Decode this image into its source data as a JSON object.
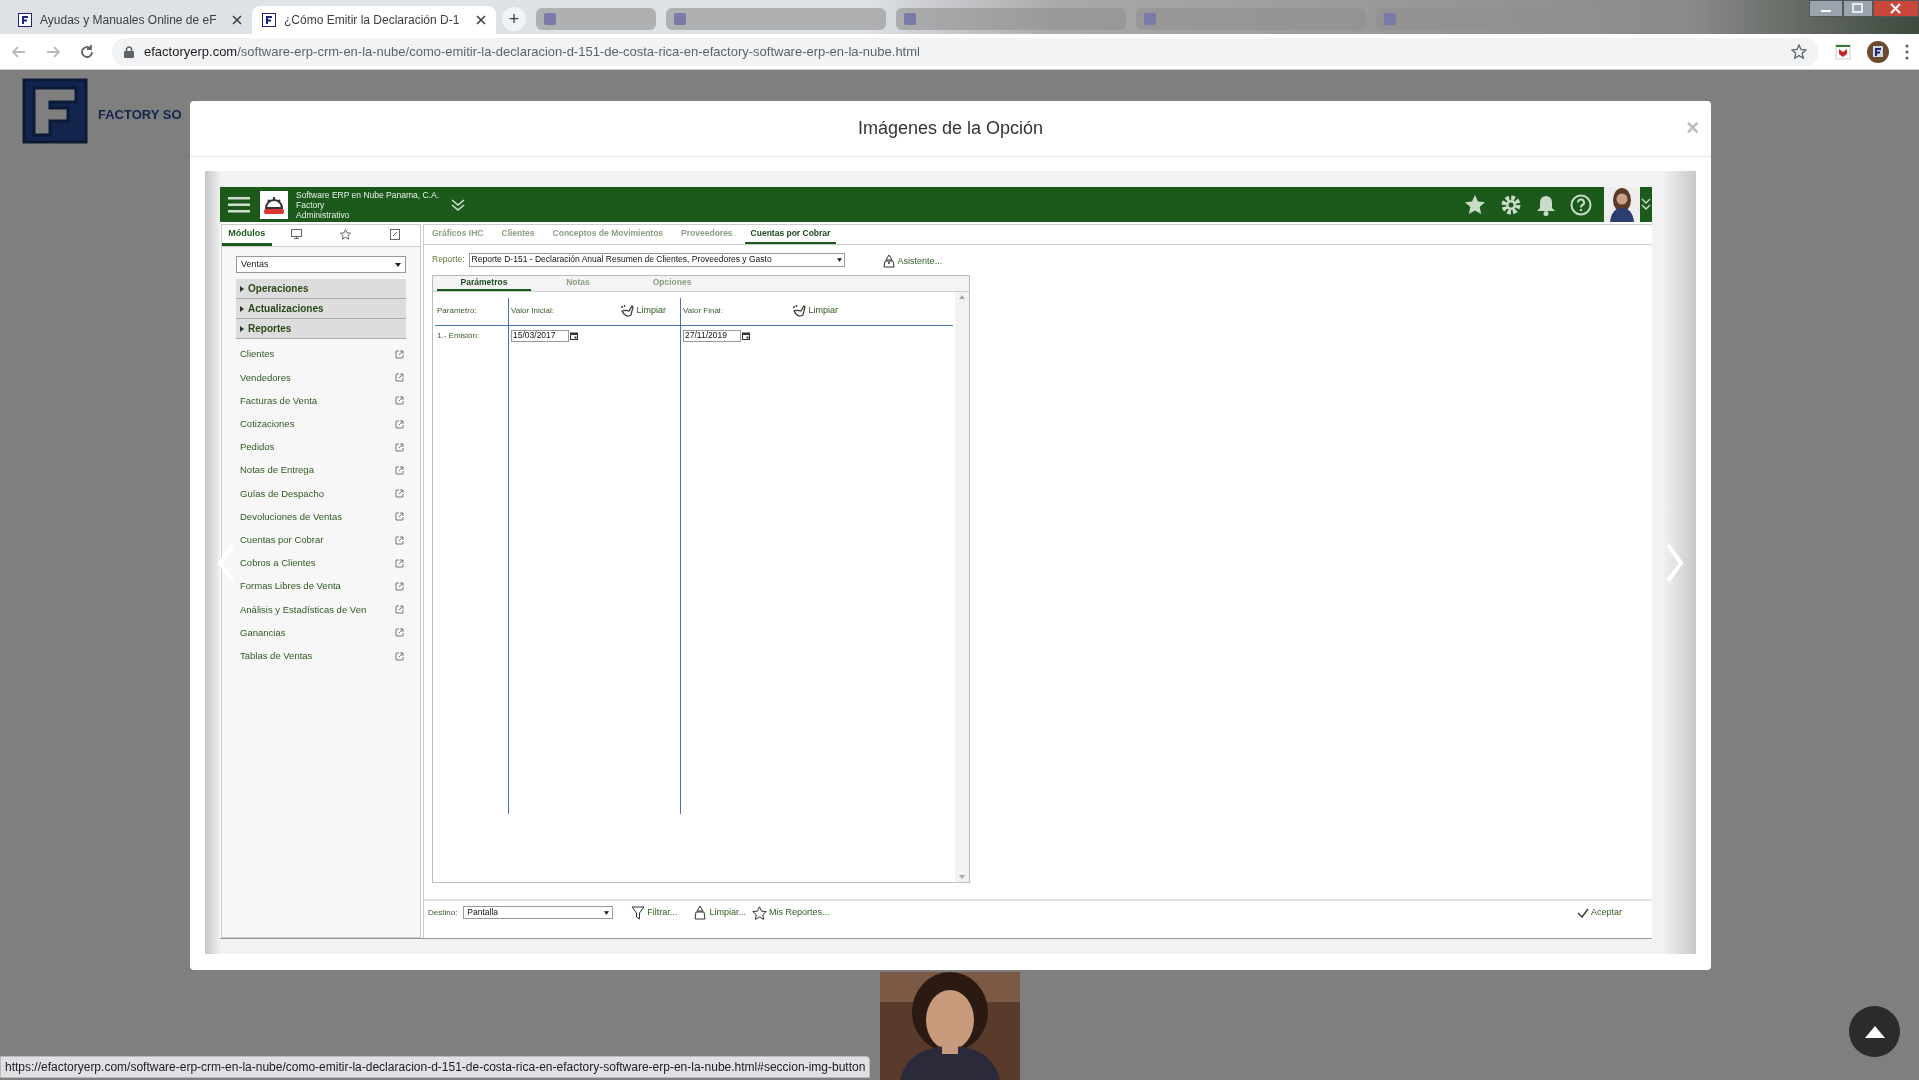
{
  "browser": {
    "tabs": [
      {
        "title": "Ayudas y Manuales Online de eF",
        "selected": false
      },
      {
        "title": "¿Cómo Emitir la Declaración D-1",
        "selected": true
      }
    ],
    "new_tab": "+",
    "url_domain": "efactoryerp.com",
    "url_path": "/software-erp-crm-en-la-nube/como-emitir-la-declaracion-d-151-de-costa-rica-en-efactory-software-erp-en-la-nube.html"
  },
  "page": {
    "brand": "FACTORY SO"
  },
  "modal": {
    "title": "Imágenes de la Opción",
    "close": "×"
  },
  "app": {
    "company": "Software ERP en Nube Panama, C.A.",
    "user": "Factory",
    "role": "Administrativo",
    "sidebar_tabs": [
      {
        "kind": "text",
        "label": "Módulos",
        "selected": true
      },
      {
        "kind": "monitor",
        "selected": false
      },
      {
        "kind": "star",
        "selected": false
      },
      {
        "kind": "note",
        "selected": false
      }
    ],
    "module_select": "Ventas",
    "groups": [
      {
        "label": "Operaciones",
        "expanded": false
      },
      {
        "label": "Actualizaciones",
        "expanded": false
      },
      {
        "label": "Reportes",
        "expanded": false
      }
    ],
    "items": [
      "Clientes",
      "Vendedores",
      "Facturas de Venta",
      "Cotizaciones",
      "Pedidos",
      "Notas de Entrega",
      "Guías de Despacho",
      "Devoluciones de Ventas",
      "Cuentas por Cobrar",
      "Cobros a Clientes",
      "Formas Libres de Venta",
      "Análisis y Estadísticas de Ven",
      "Ganancias",
      "Tablas de Ventas"
    ],
    "tabs": [
      {
        "label": "Gráficos IHC",
        "selected": false
      },
      {
        "label": "Clientes",
        "selected": false
      },
      {
        "label": "Conceptos de Movimientos",
        "selected": false
      },
      {
        "label": "Proveedores",
        "selected": false
      },
      {
        "label": "Cuentas por Cobrar",
        "selected": true
      }
    ],
    "report_label": "Reporte:",
    "report_value": "Reporte D-151 - Declaración Anual Resumen de Clientes, Proveedores y Gasto",
    "wizard": "Asistente...",
    "sub_tabs": [
      {
        "label": "Parámetros",
        "selected": true
      },
      {
        "label": "Notas",
        "selected": false
      },
      {
        "label": "Opciones",
        "selected": false
      }
    ],
    "param_header": "Parámetro:",
    "initial_header": "Valor Inicial:",
    "final_header": "Valor Final:",
    "clear_initial": "Limpiar",
    "clear_final": "Limpiar",
    "params": [
      {
        "name": "1.- Emisión:",
        "initial": "15/03/2017",
        "final": "27/11/2019"
      }
    ],
    "footer": {
      "destination_label": "Destino:",
      "destination": "Pantalla",
      "filter": "Filtrar...",
      "clear": "Limpiar...",
      "my_reports": "Mis Reportes...",
      "accept": "Aceptar"
    }
  },
  "status_url": "https://efactoryerp.com/software-erp-crm-en-la-nube/como-emitir-la-declaracion-d-151-de-costa-rica-en-efactory-software-erp-en-la-nube.html#seccion-img-button"
}
